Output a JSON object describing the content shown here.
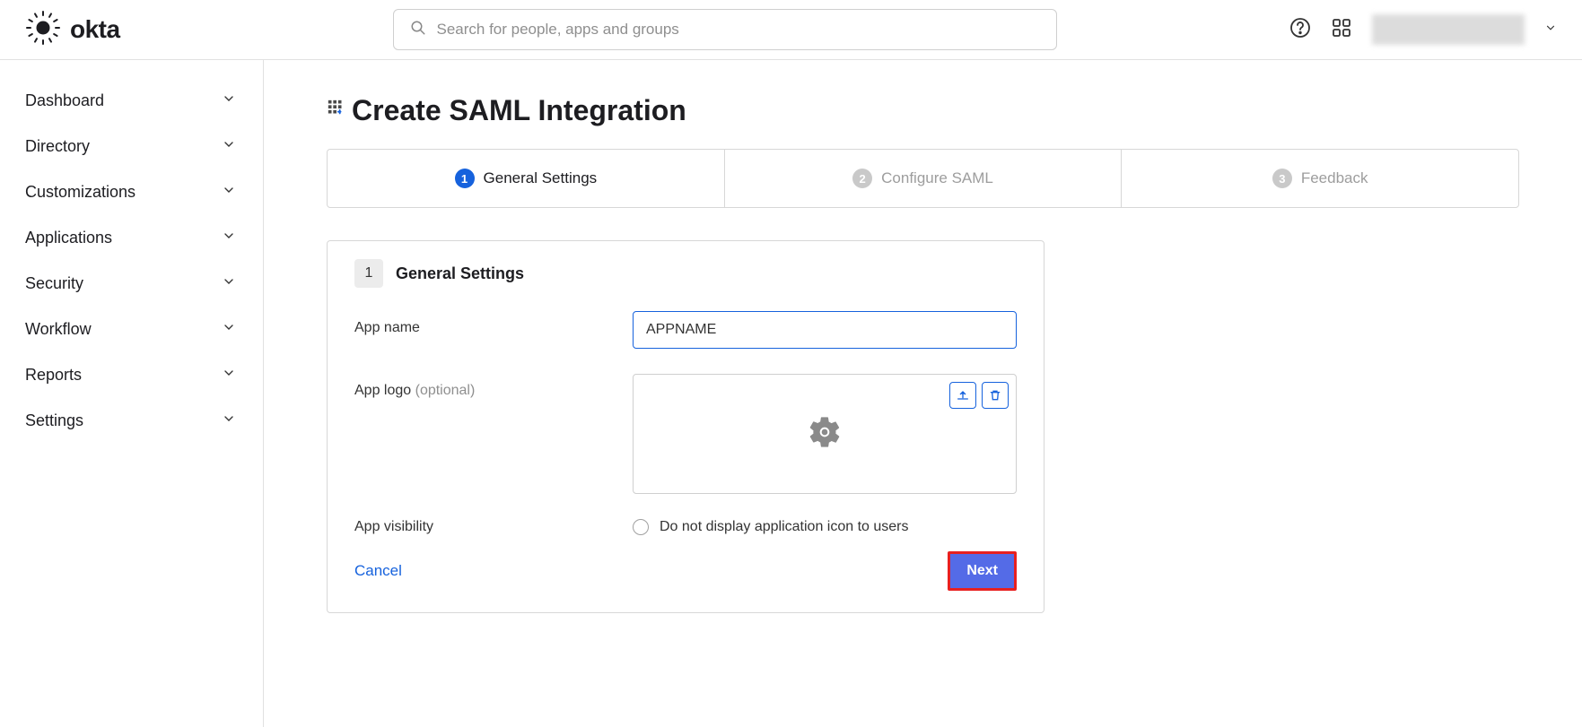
{
  "header": {
    "logo_text": "okta",
    "search_placeholder": "Search for people, apps and groups"
  },
  "sidebar": {
    "items": [
      {
        "label": "Dashboard"
      },
      {
        "label": "Directory"
      },
      {
        "label": "Customizations"
      },
      {
        "label": "Applications"
      },
      {
        "label": "Security"
      },
      {
        "label": "Workflow"
      },
      {
        "label": "Reports"
      },
      {
        "label": "Settings"
      }
    ]
  },
  "page": {
    "title": "Create SAML Integration",
    "steps": [
      {
        "num": "1",
        "label": "General Settings",
        "active": true
      },
      {
        "num": "2",
        "label": "Configure SAML",
        "active": false
      },
      {
        "num": "3",
        "label": "Feedback",
        "active": false
      }
    ]
  },
  "panel": {
    "step_num": "1",
    "title": "General Settings",
    "app_name_label": "App name",
    "app_name_value": "APPNAME",
    "app_logo_label": "App logo ",
    "app_logo_optional": "(optional)",
    "app_visibility_label": "App visibility",
    "visibility_checkbox_label": "Do not display application icon to users",
    "cancel_label": "Cancel",
    "next_label": "Next"
  }
}
